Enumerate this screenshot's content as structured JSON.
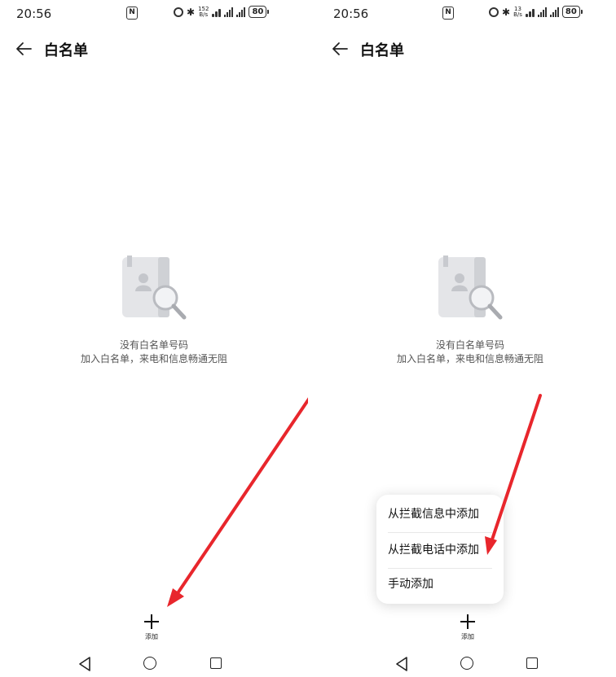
{
  "screens": [
    {
      "status": {
        "time": "20:56",
        "nfc": "N",
        "net_speed_value": "152",
        "net_speed_unit": "B/s",
        "battery": "80"
      },
      "title": "白名单",
      "empty": {
        "title": "没有白名单号码",
        "subtitle": "加入白名单，来电和信息畅通无阻"
      },
      "add_label": "添加"
    },
    {
      "status": {
        "time": "20:56",
        "nfc": "N",
        "net_speed_value": "13",
        "net_speed_unit": "B/s",
        "battery": "80"
      },
      "title": "白名单",
      "empty": {
        "title": "没有白名单号码",
        "subtitle": "加入白名单，来电和信息畅通无阻"
      },
      "add_label": "添加",
      "menu": [
        {
          "label": "从拦截信息中添加"
        },
        {
          "label": "从拦截电话中添加"
        },
        {
          "label": "手动添加"
        }
      ]
    }
  ],
  "icons": [
    "nfc-icon",
    "alarm-icon",
    "bluetooth-icon",
    "wifi-icon",
    "signal-icon",
    "battery-icon",
    "back-arrow-icon",
    "contacts-search-icon",
    "plus-icon",
    "nav-back-icon",
    "nav-home-icon",
    "nav-recent-icon",
    "annotation-arrow"
  ],
  "colors": {
    "annotation": "#e8262c",
    "background": "#ffffff",
    "text": "#111111",
    "secondary_text": "#555555"
  }
}
